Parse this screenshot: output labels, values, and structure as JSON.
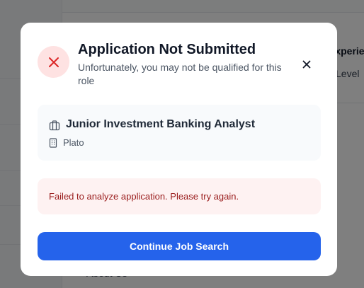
{
  "background": {
    "text_1": "Experience",
    "text_2": "Level",
    "text_3": "About Us"
  },
  "modal": {
    "title": "Application Not Submitted",
    "subtitle": "Unfortunately, you may not be qualified for this role",
    "status_icon": "x-icon",
    "close_icon": "close-icon",
    "job": {
      "title": "Junior Investment Banking Analyst",
      "company": "Plato",
      "job_icon": "briefcase-icon",
      "company_icon": "building-icon"
    },
    "error_message": "Failed to analyze application. Please try again.",
    "primary_button_label": "Continue Job Search"
  },
  "colors": {
    "primary": "#2563eb",
    "error_text": "#991b1b",
    "error_bg": "#fef2f2",
    "error_icon": "#dc2626",
    "error_icon_bg": "#fee2e2"
  }
}
